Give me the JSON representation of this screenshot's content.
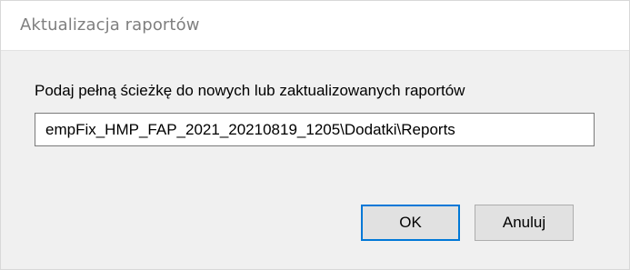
{
  "window": {
    "title": "Aktualizacja raportów"
  },
  "form": {
    "prompt": "Podaj pełną ścieżkę do nowych lub zaktualizowanych raportów",
    "path_value": "empFix_HMP_FAP_2021_20210819_1205\\Dodatki\\Reports"
  },
  "buttons": {
    "ok_label": "OK",
    "cancel_label": "Anuluj"
  },
  "colors": {
    "title_text": "#7f7f7f",
    "dialog_background": "#f0f0f0",
    "default_button_border": "#0078d7"
  }
}
